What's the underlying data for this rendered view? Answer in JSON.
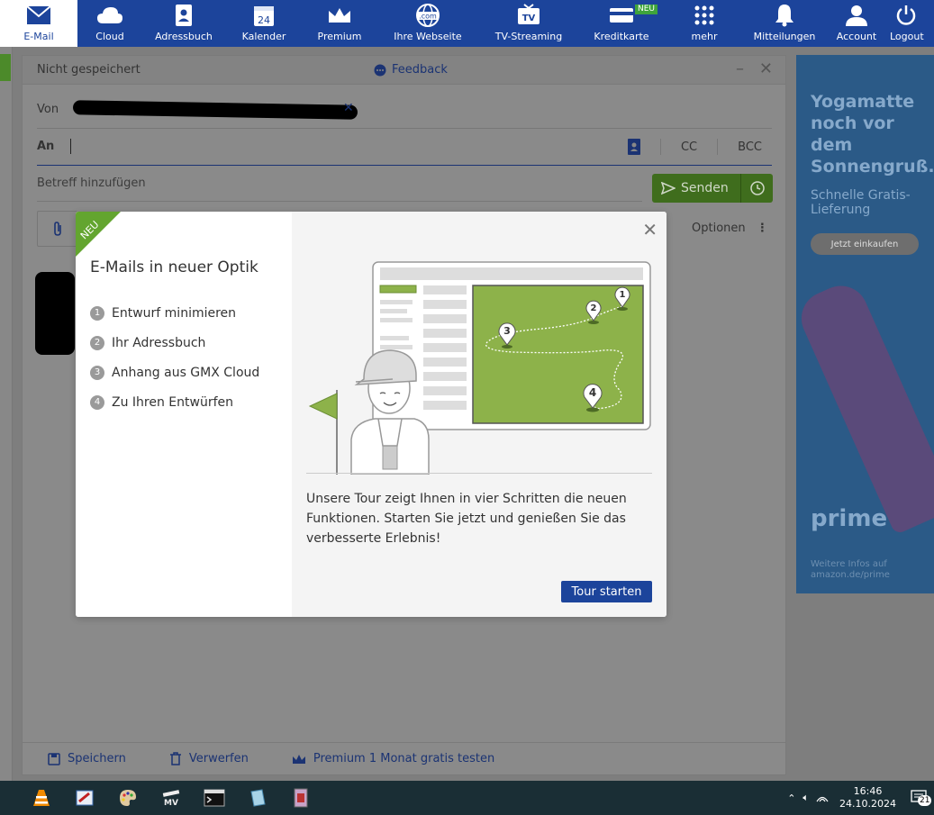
{
  "nav": {
    "items": [
      {
        "label": "E-Mail",
        "icon": "envelope-icon",
        "active": true
      },
      {
        "label": "Cloud",
        "icon": "cloud-icon"
      },
      {
        "label": "Adressbuch",
        "icon": "address-book-icon"
      },
      {
        "label": "Kalender",
        "icon": "calendar-icon",
        "day": "24"
      },
      {
        "label": "Premium",
        "icon": "crown-icon"
      },
      {
        "label": "Ihre Webseite",
        "icon": "globe-icon",
        "sub": ".com"
      },
      {
        "label": "TV-Streaming",
        "icon": "tv-icon",
        "sub": "TV"
      },
      {
        "label": "Kreditkarte",
        "icon": "credit-card-icon",
        "badge": "NEU"
      },
      {
        "label": "mehr",
        "icon": "grid-icon"
      },
      {
        "label": "Mitteilungen",
        "icon": "bell-icon"
      },
      {
        "label": "Account",
        "icon": "user-icon"
      },
      {
        "label": "Logout",
        "icon": "power-icon"
      }
    ]
  },
  "compose": {
    "status": "Nicht gespeichert",
    "feedback": "Feedback",
    "from_label": "Von",
    "to_label": "An",
    "cc": "CC",
    "bcc": "BCC",
    "subject_placeholder": "Betreff hinzufügen",
    "send_label": "Senden",
    "options_label": "Optionen",
    "footer": {
      "save": "Speichern",
      "discard": "Verwerfen",
      "premium": "Premium 1 Monat gratis testen"
    }
  },
  "ad": {
    "title": "Yogamatte noch vor dem Sonnengruß.",
    "subtitle": "Schnelle Gratis-Lieferung",
    "button": "Jetzt einkaufen",
    "brand": "prime",
    "info": "Weitere Infos auf amazon.de/prime"
  },
  "modal": {
    "ribbon": "NEU",
    "title": "E-Mails in neuer Optik",
    "steps": [
      {
        "num": "1",
        "label": "Entwurf minimieren"
      },
      {
        "num": "2",
        "label": "Ihr Adressbuch"
      },
      {
        "num": "3",
        "label": "Anhang aus GMX Cloud"
      },
      {
        "num": "4",
        "label": "Zu Ihren Entwürfen"
      }
    ],
    "description": "Unsere Tour zeigt Ihnen in vier Schritten die neuen Funktionen. Starten Sie jetzt und genießen Sie das verbesserte Erlebnis!",
    "button": "Tour starten",
    "map_pins": [
      "1",
      "2",
      "3",
      "4"
    ],
    "accent_color": "#8db24a"
  },
  "taskbar": {
    "time": "16:46",
    "date": "24.10.2024",
    "notifications": "21",
    "apps": [
      "vlc-icon",
      "paint-icon",
      "palette-icon",
      "movie-maker-icon",
      "terminal-icon",
      "notepad-icon",
      "archive-icon"
    ]
  }
}
